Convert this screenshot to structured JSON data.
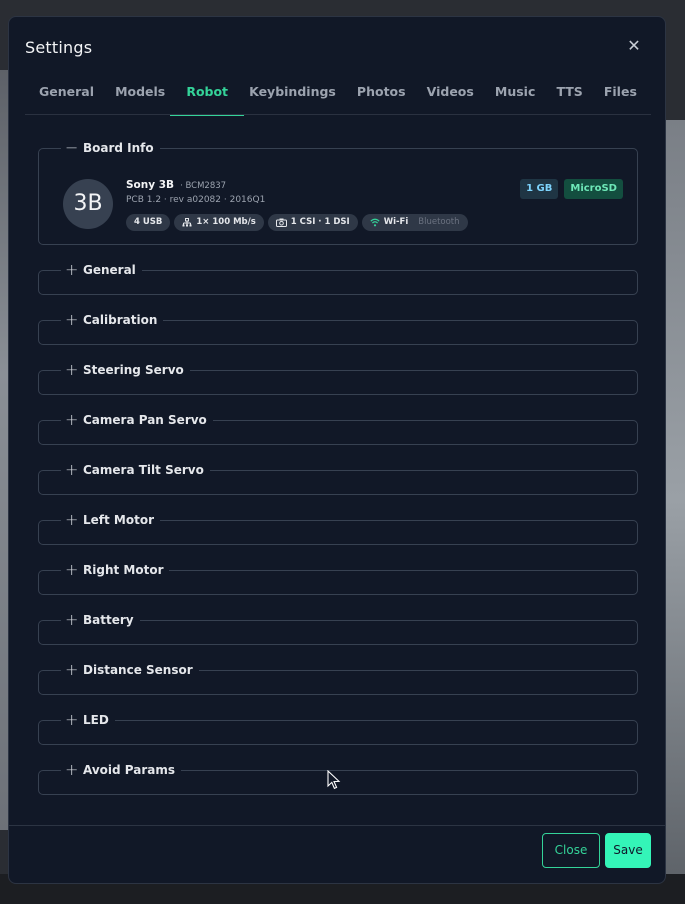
{
  "modal": {
    "title": "Settings",
    "close_icon": "close-icon"
  },
  "tabs": [
    {
      "label": "General"
    },
    {
      "label": "Models"
    },
    {
      "label": "Robot",
      "active": true
    },
    {
      "label": "Keybindings"
    },
    {
      "label": "Photos"
    },
    {
      "label": "Videos"
    },
    {
      "label": "Music"
    },
    {
      "label": "TTS"
    },
    {
      "label": "Files"
    }
  ],
  "board_info": {
    "title": "Board Info",
    "avatar": "3B",
    "model": "Sony 3B",
    "chip": "· BCM2837",
    "pcb": "PCB 1.2 · rev a02082 · 2016Q1",
    "ram": "1 GB",
    "storage": "MicroSD",
    "pills": {
      "usb": "4 USB",
      "ethernet": "1× 100 Mb/s",
      "camera": "1 CSI · 1 DSI",
      "wifi": "Wi-Fi",
      "bluetooth": "Bluetooth"
    }
  },
  "sections": [
    {
      "title": "General"
    },
    {
      "title": "Calibration"
    },
    {
      "title": "Steering Servo"
    },
    {
      "title": "Camera Pan Servo"
    },
    {
      "title": "Camera Tilt Servo"
    },
    {
      "title": "Left Motor"
    },
    {
      "title": "Right Motor"
    },
    {
      "title": "Battery"
    },
    {
      "title": "Distance Sensor"
    },
    {
      "title": "LED"
    },
    {
      "title": "Avoid Params"
    }
  ],
  "footer": {
    "close_label": "Close",
    "save_label": "Save"
  },
  "colors": {
    "accent": "#34d399",
    "modal_bg": "#111827",
    "save_bg": "#34f5b8"
  }
}
